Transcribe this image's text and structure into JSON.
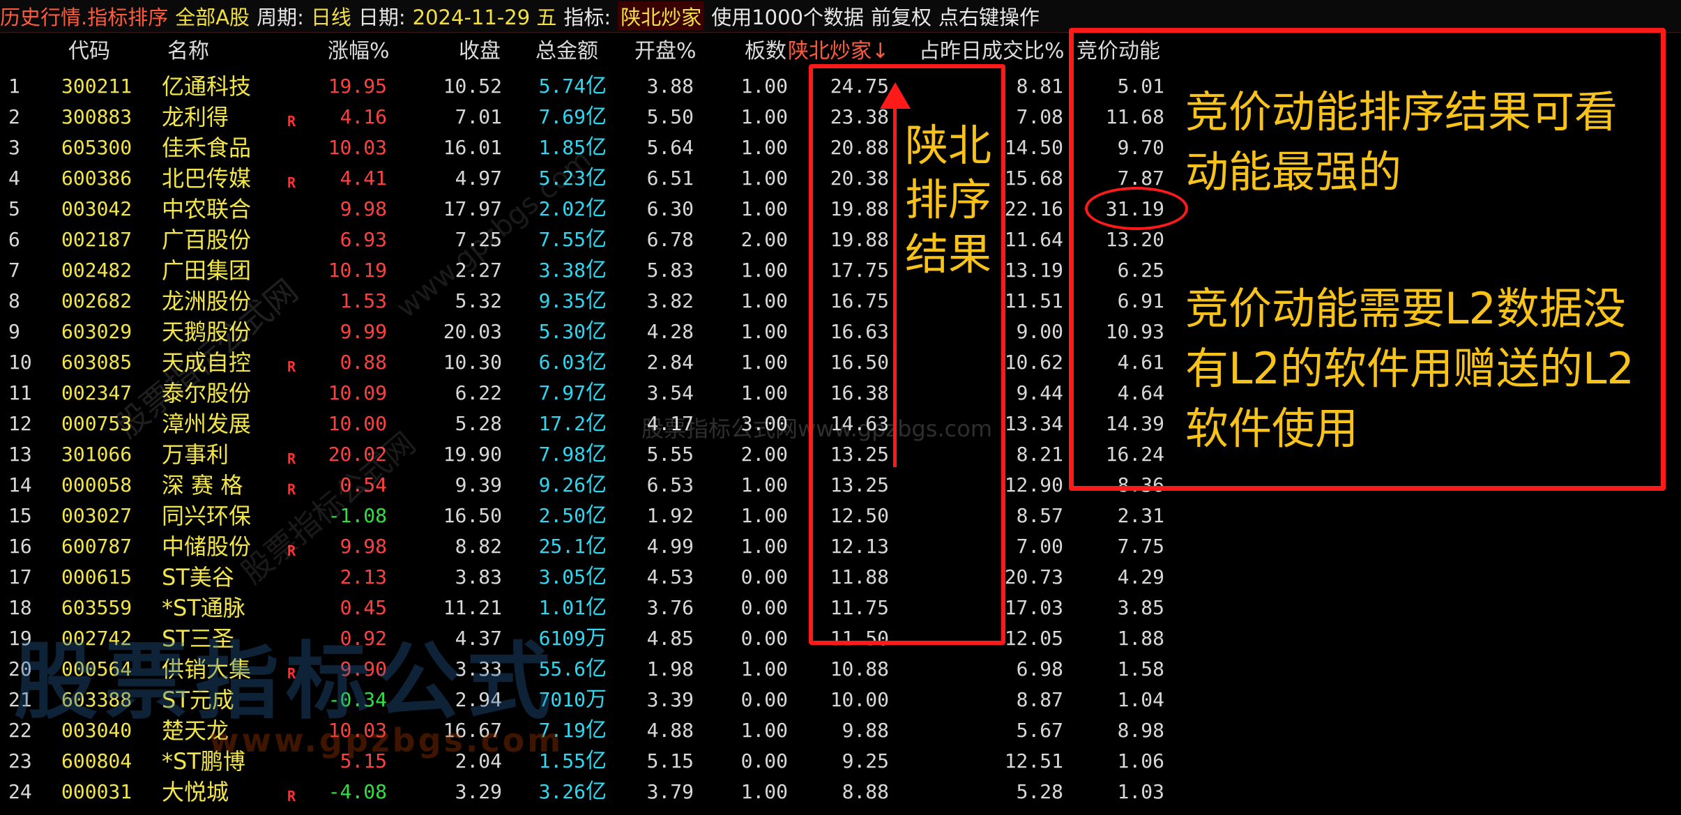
{
  "topbar": {
    "title": "历史行情.指标排序",
    "scope": "全部A股",
    "period_label": "周期:",
    "period_value": "日线",
    "date_label": "日期:",
    "date_value": "2024-11-29 五",
    "indicator_label": "指标:",
    "indicator_value": "陕北炒家",
    "data_note": "使用1000个数据",
    "adjust": "前复权",
    "right_click": "点右键操作"
  },
  "headers": {
    "code": "代码",
    "name": "名称",
    "rise": "涨幅%",
    "close": "收盘",
    "amount": "总金额",
    "open": "开盘%",
    "board": "板数",
    "sx": "陕北炒家↓",
    "ratio": "占昨日成交比%",
    "auction": "竞价动能"
  },
  "rows": [
    {
      "num": "1",
      "code": "300211",
      "name": "亿通科技",
      "flag": "",
      "rise": "19.95",
      "dir": "up",
      "close": "10.52",
      "amount": "5.74",
      "unit": "亿",
      "open": "3.88",
      "board": "1.00",
      "sx": "24.75",
      "ratio": "8.81",
      "auction": "5.01"
    },
    {
      "num": "2",
      "code": "300883",
      "name": "龙利得",
      "flag": "R",
      "rise": "4.16",
      "dir": "up",
      "close": "7.01",
      "amount": "7.69",
      "unit": "亿",
      "open": "5.50",
      "board": "1.00",
      "sx": "23.38",
      "ratio": "7.08",
      "auction": "11.68"
    },
    {
      "num": "3",
      "code": "605300",
      "name": "佳禾食品",
      "flag": "",
      "rise": "10.03",
      "dir": "up",
      "close": "16.01",
      "amount": "1.85",
      "unit": "亿",
      "open": "5.64",
      "board": "1.00",
      "sx": "20.88",
      "ratio": "14.50",
      "auction": "9.70"
    },
    {
      "num": "4",
      "code": "600386",
      "name": "北巴传媒",
      "flag": "R",
      "rise": "4.41",
      "dir": "up",
      "close": "4.97",
      "amount": "5.23",
      "unit": "亿",
      "open": "6.51",
      "board": "1.00",
      "sx": "20.38",
      "ratio": "15.68",
      "auction": "7.87"
    },
    {
      "num": "5",
      "code": "003042",
      "name": "中农联合",
      "flag": "",
      "rise": "9.98",
      "dir": "up",
      "close": "17.97",
      "amount": "2.02",
      "unit": "亿",
      "open": "6.30",
      "board": "1.00",
      "sx": "19.88",
      "ratio": "22.16",
      "auction": "31.19"
    },
    {
      "num": "6",
      "code": "002187",
      "name": "广百股份",
      "flag": "",
      "rise": "6.93",
      "dir": "up",
      "close": "7.25",
      "amount": "7.55",
      "unit": "亿",
      "open": "6.78",
      "board": "2.00",
      "sx": "19.88",
      "ratio": "11.64",
      "auction": "13.20"
    },
    {
      "num": "7",
      "code": "002482",
      "name": "广田集团",
      "flag": "",
      "rise": "10.19",
      "dir": "up",
      "close": "2.27",
      "amount": "3.38",
      "unit": "亿",
      "open": "5.83",
      "board": "1.00",
      "sx": "17.75",
      "ratio": "13.19",
      "auction": "6.25"
    },
    {
      "num": "8",
      "code": "002682",
      "name": "龙洲股份",
      "flag": "",
      "rise": "1.53",
      "dir": "up",
      "close": "5.32",
      "amount": "9.35",
      "unit": "亿",
      "open": "3.82",
      "board": "1.00",
      "sx": "16.75",
      "ratio": "11.51",
      "auction": "6.91"
    },
    {
      "num": "9",
      "code": "603029",
      "name": "天鹅股份",
      "flag": "",
      "rise": "9.99",
      "dir": "up",
      "close": "20.03",
      "amount": "5.30",
      "unit": "亿",
      "open": "4.28",
      "board": "1.00",
      "sx": "16.63",
      "ratio": "9.00",
      "auction": "10.93"
    },
    {
      "num": "10",
      "code": "603085",
      "name": "天成自控",
      "flag": "R",
      "rise": "0.88",
      "dir": "up",
      "close": "10.30",
      "amount": "6.03",
      "unit": "亿",
      "open": "2.84",
      "board": "1.00",
      "sx": "16.50",
      "ratio": "10.62",
      "auction": "4.61"
    },
    {
      "num": "11",
      "code": "002347",
      "name": "泰尔股份",
      "flag": "",
      "rise": "10.09",
      "dir": "up",
      "close": "6.22",
      "amount": "7.97",
      "unit": "亿",
      "open": "3.54",
      "board": "1.00",
      "sx": "16.38",
      "ratio": "9.44",
      "auction": "4.64"
    },
    {
      "num": "12",
      "code": "000753",
      "name": "漳州发展",
      "flag": "",
      "rise": "10.00",
      "dir": "up",
      "close": "5.28",
      "amount": "17.2",
      "unit": "亿",
      "open": "4.17",
      "board": "3.00",
      "sx": "14.63",
      "ratio": "13.34",
      "auction": "14.39"
    },
    {
      "num": "13",
      "code": "301066",
      "name": "万事利",
      "flag": "R",
      "rise": "20.02",
      "dir": "up",
      "close": "19.90",
      "amount": "7.98",
      "unit": "亿",
      "open": "5.55",
      "board": "2.00",
      "sx": "13.25",
      "ratio": "8.21",
      "auction": "16.24"
    },
    {
      "num": "14",
      "code": "000058",
      "name": "深 赛 格",
      "flag": "R",
      "rise": "0.54",
      "dir": "up",
      "close": "9.39",
      "amount": "9.26",
      "unit": "亿",
      "open": "6.53",
      "board": "1.00",
      "sx": "13.25",
      "ratio": "12.90",
      "auction": "8.36"
    },
    {
      "num": "15",
      "code": "003027",
      "name": "同兴环保",
      "flag": "",
      "rise": "-1.08",
      "dir": "down",
      "close": "16.50",
      "amount": "2.50",
      "unit": "亿",
      "open": "1.92",
      "board": "1.00",
      "sx": "12.50",
      "ratio": "8.57",
      "auction": "2.31"
    },
    {
      "num": "16",
      "code": "600787",
      "name": "中储股份",
      "flag": "R",
      "rise": "9.98",
      "dir": "up",
      "close": "8.82",
      "amount": "25.1",
      "unit": "亿",
      "open": "4.99",
      "board": "1.00",
      "sx": "12.13",
      "ratio": "7.00",
      "auction": "7.75"
    },
    {
      "num": "17",
      "code": "000615",
      "name": "ST美谷",
      "flag": "",
      "rise": "2.13",
      "dir": "up",
      "close": "3.83",
      "amount": "3.05",
      "unit": "亿",
      "open": "4.53",
      "board": "0.00",
      "sx": "11.88",
      "ratio": "20.73",
      "auction": "4.29"
    },
    {
      "num": "18",
      "code": "603559",
      "name": "*ST通脉",
      "flag": "",
      "rise": "0.45",
      "dir": "up",
      "close": "11.21",
      "amount": "1.01",
      "unit": "亿",
      "open": "3.76",
      "board": "0.00",
      "sx": "11.75",
      "ratio": "17.03",
      "auction": "3.85"
    },
    {
      "num": "19",
      "code": "002742",
      "name": "ST三圣",
      "flag": "",
      "rise": "0.92",
      "dir": "up",
      "close": "4.37",
      "amount": "6109",
      "unit": "万",
      "open": "4.85",
      "board": "0.00",
      "sx": "11.50",
      "ratio": "12.05",
      "auction": "1.88"
    },
    {
      "num": "20",
      "code": "000564",
      "name": "供销大集",
      "flag": "R",
      "rise": "9.90",
      "dir": "up",
      "close": "3.33",
      "amount": "55.6",
      "unit": "亿",
      "open": "1.98",
      "board": "1.00",
      "sx": "10.88",
      "ratio": "6.98",
      "auction": "1.58"
    },
    {
      "num": "21",
      "code": "603388",
      "name": "ST元成",
      "flag": "",
      "rise": "-0.34",
      "dir": "down",
      "close": "2.94",
      "amount": "7010",
      "unit": "万",
      "open": "3.39",
      "board": "0.00",
      "sx": "10.00",
      "ratio": "8.87",
      "auction": "1.04"
    },
    {
      "num": "22",
      "code": "003040",
      "name": "楚天龙",
      "flag": "",
      "rise": "10.03",
      "dir": "up",
      "close": "16.67",
      "amount": "7.19",
      "unit": "亿",
      "open": "4.88",
      "board": "1.00",
      "sx": "9.88",
      "ratio": "5.67",
      "auction": "8.98"
    },
    {
      "num": "23",
      "code": "600804",
      "name": "*ST鹏博",
      "flag": "",
      "rise": "5.15",
      "dir": "up",
      "close": "2.04",
      "amount": "1.55",
      "unit": "亿",
      "open": "5.15",
      "board": "0.00",
      "sx": "9.25",
      "ratio": "12.51",
      "auction": "1.06"
    },
    {
      "num": "24",
      "code": "000031",
      "name": "大悦城",
      "flag": "R",
      "rise": "-4.08",
      "dir": "down",
      "close": "3.29",
      "amount": "3.26",
      "unit": "亿",
      "open": "3.79",
      "board": "1.00",
      "sx": "8.88",
      "ratio": "5.28",
      "auction": "1.03"
    }
  ],
  "annotations": {
    "sx_note": "陕北排序结果",
    "auction_note_1": "竞价动能排序结果可看动能最强的",
    "auction_note_2": "竞价动能需要L2数据没有L2的软件用赠送的L2软件使用"
  },
  "watermarks": {
    "wm1": "股票指标公式网",
    "wm2": "股票指标公式网",
    "wm3": "www.gpzbgs.com",
    "wm4": "股票指标公式网www.gpzbgs.com",
    "wm5": "股票指标公式",
    "wm6": "www.gpzbgs.com"
  },
  "colors": {
    "up": "#ff4040",
    "down": "#30e040",
    "code_name": "#f2e54a",
    "amount": "#2fd8f0",
    "annotation": "#f7c21a",
    "box": "#ff1a1a"
  }
}
